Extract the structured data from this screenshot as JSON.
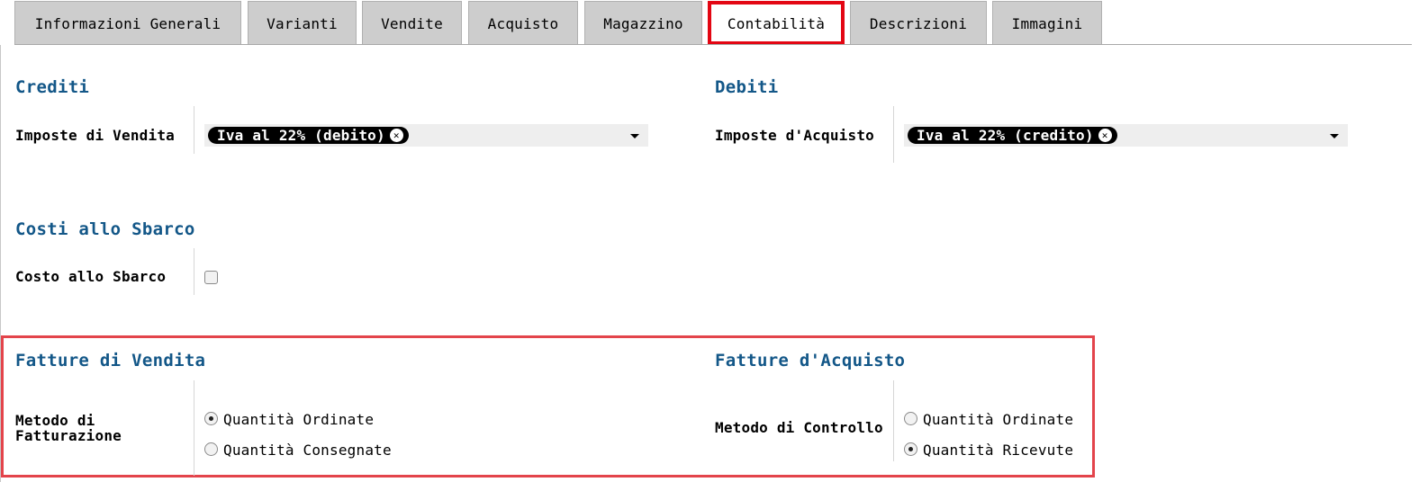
{
  "tabs": [
    {
      "label": "Informazioni Generali"
    },
    {
      "label": "Varianti"
    },
    {
      "label": "Vendite"
    },
    {
      "label": "Acquisto"
    },
    {
      "label": "Magazzino"
    },
    {
      "label": "Contabilità",
      "active": true
    },
    {
      "label": "Descrizioni"
    },
    {
      "label": "Immagini"
    }
  ],
  "crediti": {
    "title": "Crediti",
    "field_label": "Imposte di Vendita",
    "tag": "Iva al 22% (debito)"
  },
  "debiti": {
    "title": "Debiti",
    "field_label": "Imposte d'Acquisto",
    "tag": "Iva al 22% (credito)"
  },
  "costi": {
    "title": "Costi allo Sbarco",
    "field_label": "Costo allo Sbarco",
    "checked": false
  },
  "fatture_vendita": {
    "title": "Fatture di Vendita",
    "field_label_line1": "Metodo di",
    "field_label_line2": "Fatturazione",
    "options": [
      {
        "label": "Quantità Ordinate",
        "selected": true
      },
      {
        "label": "Quantità Consegnate",
        "selected": false
      }
    ]
  },
  "fatture_acquisto": {
    "title": "Fatture d'Acquisto",
    "field_label": "Metodo di Controllo",
    "options": [
      {
        "label": "Quantità Ordinate",
        "selected": false
      },
      {
        "label": "Quantità Ricevute",
        "selected": true
      }
    ]
  },
  "colors": {
    "section_title": "#135788",
    "highlight": "#e3444b",
    "active_tab_border": "#e30613"
  },
  "icons": {
    "remove_tag": "close-circle-icon",
    "dropdown": "caret-down-icon"
  }
}
